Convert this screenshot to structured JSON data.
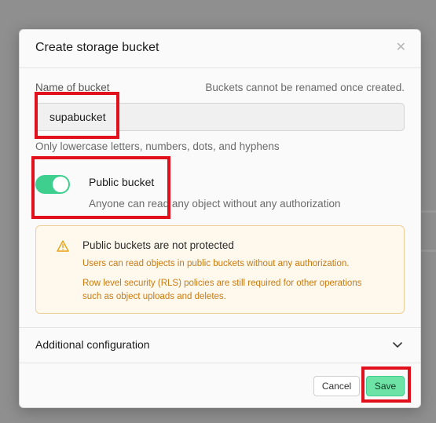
{
  "modal": {
    "title": "Create storage bucket",
    "close_icon": "close-icon"
  },
  "name_field": {
    "label": "Name of bucket",
    "hint": "Buckets cannot be renamed once created.",
    "value": "supabucket",
    "description": "Only lowercase letters, numbers, dots, and hyphens"
  },
  "public_toggle": {
    "state": "on",
    "label": "Public bucket",
    "description": "Anyone can read any object without any authorization",
    "accent_color": "#3ecf8e"
  },
  "warning": {
    "icon": "warning-triangle-icon",
    "title": "Public buckets are not protected",
    "line1": "Users can read objects in public buckets without any authorization.",
    "line2": "Row level security (RLS) policies are still required for other operations such as object uploads and deletes.",
    "text_color": "#c97a10"
  },
  "additional_config": {
    "label": "Additional configuration",
    "icon": "chevron-down-icon"
  },
  "footer": {
    "cancel_label": "Cancel",
    "save_label": "Save"
  },
  "highlight_color": "#e0101c"
}
